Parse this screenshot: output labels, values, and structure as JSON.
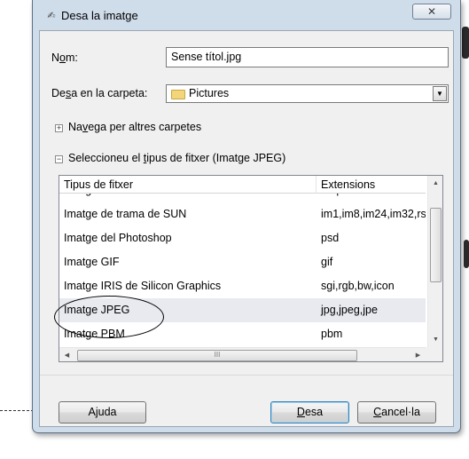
{
  "window": {
    "title": "Desa la imatge",
    "close_label": "✕"
  },
  "form": {
    "name_label_pre": "N",
    "name_label_ul": "o",
    "name_label_post": "m:",
    "name_value": "Sense títol.jpg",
    "folder_label_pre": "De",
    "folder_label_ul": "s",
    "folder_label_post": "a en la carpeta:",
    "folder_value": "Pictures",
    "browse_pre": "Na",
    "browse_ul": "v",
    "browse_post": "ega per altres carpetes",
    "filetype_pre": "Seleccioneu el ",
    "filetype_ul": "t",
    "filetype_post": "ipus de fitxer (Imatge JPEG)"
  },
  "filetype_list": {
    "columns": [
      "Tipus de fitxer",
      "Extensions"
    ],
    "rows": [
      {
        "type": "Imatge BMP de Windows",
        "ext": "bmp"
      },
      {
        "type": "Imatge de trama de SUN",
        "ext": "im1,im8,im24,im32,rs"
      },
      {
        "type": "Imatge del Photoshop",
        "ext": "psd"
      },
      {
        "type": "Imatge GIF",
        "ext": "gif"
      },
      {
        "type": "Imatge IRIS de Silicon Graphics",
        "ext": "sgi,rgb,bw,icon"
      },
      {
        "type": "Imatge JPEG",
        "ext": "jpg,jpeg,jpe"
      },
      {
        "type": "Imatge PBM",
        "ext": "pbm"
      }
    ],
    "selected_index": 5
  },
  "buttons": {
    "help": "Ajuda",
    "save_ul": "D",
    "save_post": "esa",
    "cancel_ul": "C",
    "cancel_post": "ancel·la"
  },
  "icons": {
    "title_icon": "✍",
    "dropdown_arrow": "▼",
    "expand_collapsed": "+",
    "expand_expanded": "−",
    "scroll_up": "▲",
    "scroll_down": "▼",
    "scroll_left": "◀",
    "scroll_right": "▶",
    "grip_v": "≡",
    "grip_h": "III"
  },
  "colors": {
    "window_frame": "#cfdcea",
    "client_bg": "#f0f0f0",
    "selected_row": "#e8eaf0",
    "default_button_border": "#3c7fb1"
  }
}
